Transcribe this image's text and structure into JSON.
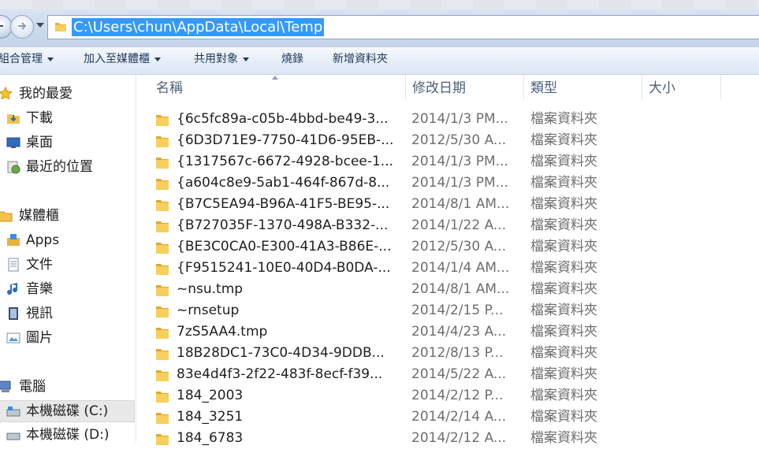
{
  "address_bar": {
    "path": "C:\\Users\\chun\\AppData\\Local\\Temp"
  },
  "toolbar": {
    "organize": "組合管理",
    "include_in_library": "加入至媒體櫃",
    "share_with": "共用對象",
    "burn": "燒錄",
    "new_folder": "新增資料夾"
  },
  "nav": {
    "favorites": "我的最愛",
    "downloads": "下載",
    "desktop": "桌面",
    "recent": "最近的位置",
    "libraries": "媒體櫃",
    "apps": "Apps",
    "documents": "文件",
    "music": "音樂",
    "videos": "視訊",
    "pictures": "圖片",
    "computer": "電腦",
    "drive_c": "本機磁碟 (C:)",
    "drive_d": "本機磁碟 (D:)"
  },
  "columns": {
    "name": "名稱",
    "date_modified": "修改日期",
    "type": "類型",
    "size": "大小"
  },
  "files": [
    {
      "name": "{6c5fc89a-c05b-4bbd-be49-3...",
      "date": "2014/1/3 PM...",
      "type": "檔案資料夾"
    },
    {
      "name": "{6D3D71E9-7750-41D6-95EB-...",
      "date": "2012/5/30 A...",
      "type": "檔案資料夾"
    },
    {
      "name": "{1317567c-6672-4928-bcee-1...",
      "date": "2014/1/3 PM...",
      "type": "檔案資料夾"
    },
    {
      "name": "{a604c8e9-5ab1-464f-867d-8...",
      "date": "2014/1/3 PM...",
      "type": "檔案資料夾"
    },
    {
      "name": "{B7C5EA94-B96A-41F5-BE95-...",
      "date": "2014/8/1 AM...",
      "type": "檔案資料夾"
    },
    {
      "name": "{B727035F-1370-498A-B332-...",
      "date": "2014/1/22 A...",
      "type": "檔案資料夾"
    },
    {
      "name": "{BE3C0CA0-E300-41A3-B86E-...",
      "date": "2012/5/30 A...",
      "type": "檔案資料夾"
    },
    {
      "name": "{F9515241-10E0-40D4-B0DA-...",
      "date": "2014/1/4 AM...",
      "type": "檔案資料夾"
    },
    {
      "name": "~nsu.tmp",
      "date": "2014/8/1 AM...",
      "type": "檔案資料夾"
    },
    {
      "name": "~rnsetup",
      "date": "2014/2/15 P...",
      "type": "檔案資料夾"
    },
    {
      "name": "7zS5AA4.tmp",
      "date": "2014/4/23 A...",
      "type": "檔案資料夾"
    },
    {
      "name": "18B28DC1-73C0-4D34-9DDB...",
      "date": "2012/8/13 P...",
      "type": "檔案資料夾"
    },
    {
      "name": "83e4d4f3-2f22-483f-8ecf-f39...",
      "date": "2014/5/22 A...",
      "type": "檔案資料夾"
    },
    {
      "name": "184_2003",
      "date": "2014/2/12 P...",
      "type": "檔案資料夾"
    },
    {
      "name": "184_3251",
      "date": "2014/2/14 A...",
      "type": "檔案資料夾"
    },
    {
      "name": "184_6783",
      "date": "2014/2/12 A...",
      "type": "檔案資料夾"
    }
  ]
}
